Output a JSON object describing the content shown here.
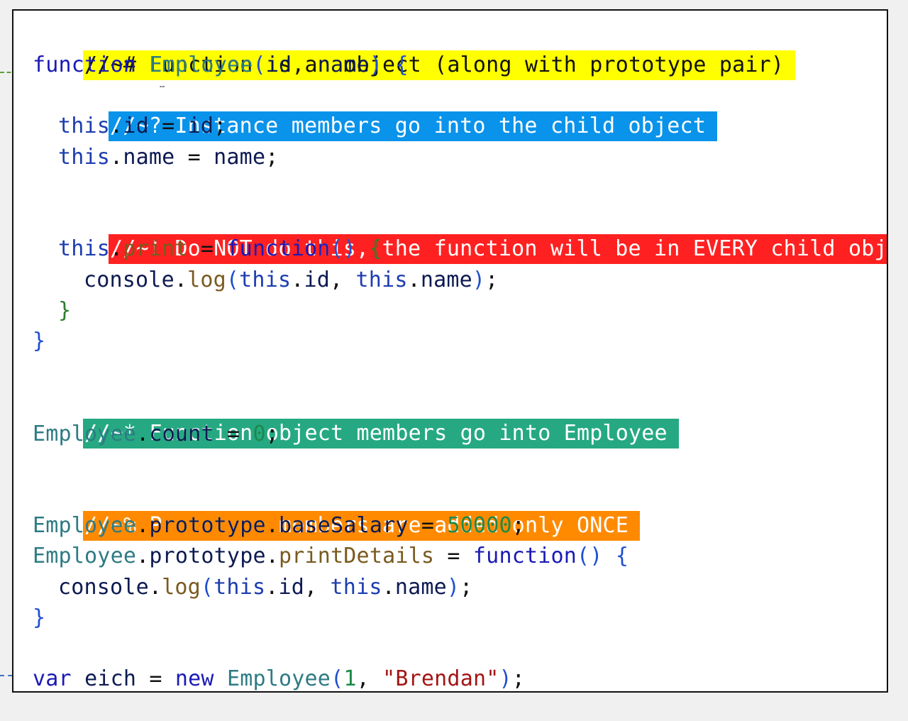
{
  "colors": {
    "page_background": "#f0f0f0",
    "editor_background": "#ffffff",
    "frame_border": "#111111",
    "hl_hash": "#ffff00",
    "hl_question": "#0a93ea",
    "hl_bang": "#ff2121",
    "hl_star": "#26a982",
    "hl_percent": "#ff8a00",
    "fold_marker_green": "#5aa23a",
    "fold_marker_blue": "#3a6ec8"
  },
  "icons": {
    "fold_marker": "dashed-line-icon",
    "ellipsis": "ellipsis-icon"
  },
  "ellipsis": "…",
  "comments": {
    "hash": "//~# Function is an object (along with prototype pair)",
    "question": "//~? Instance members go into the child object",
    "bang": "//~! Do NOT do this, the function will be in EVERY child object",
    "star": "//~* Function object members go into Employee",
    "percent": "//~% Prototype members are added only ONCE"
  },
  "code": {
    "kw_function": "function",
    "kw_var": "var",
    "kw_new": "new",
    "kw_this": "this",
    "cls_employee": "Employee",
    "id": "id",
    "name": "name",
    "print": "print",
    "console": "console",
    "log": "log",
    "count": "count",
    "prototype": "prototype",
    "baseSalary": "baseSalary",
    "printDetails": "printDetails",
    "eich": "eich",
    "num_zero": "0",
    "num_salary": "50000",
    "num_one": "1",
    "str_brendan": "\"Brendan\""
  }
}
